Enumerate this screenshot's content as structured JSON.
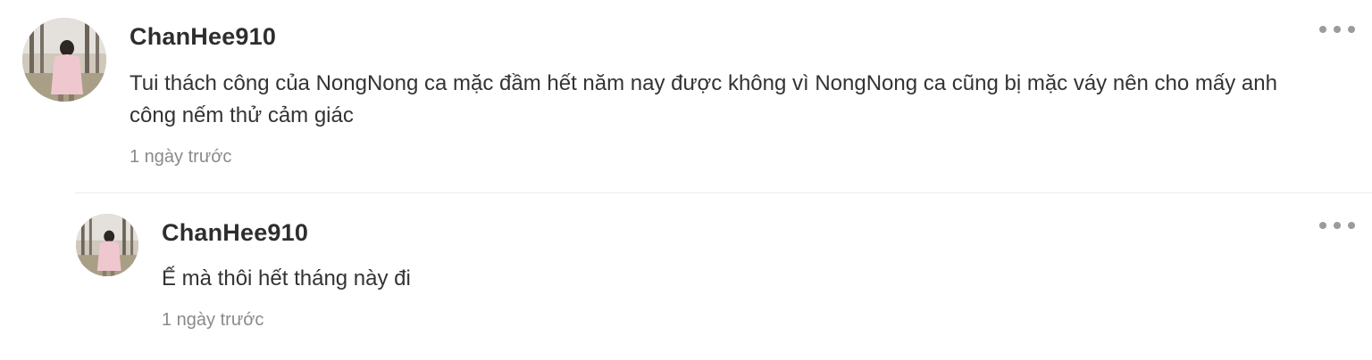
{
  "comments": [
    {
      "username": "ChanHee910",
      "text": "Tui thách công của NongNong ca mặc đầm hết năm nay được không vì NongNong ca cũng bị mặc váy nên cho mấy anh công nếm thử cảm giác",
      "timestamp": "1 ngày trước",
      "avatar_icon": "user-avatar-photo"
    },
    {
      "username": "ChanHee910",
      "text": "Ế mà thôi hết tháng này đi",
      "timestamp": "1 ngày trước",
      "avatar_icon": "user-avatar-photo",
      "is_reply": true
    }
  ],
  "colors": {
    "text": "#333333",
    "username": "#2e2e2e",
    "timestamp": "#8a8a8a",
    "divider": "#ececec",
    "more_dots": "#9e9a96"
  }
}
